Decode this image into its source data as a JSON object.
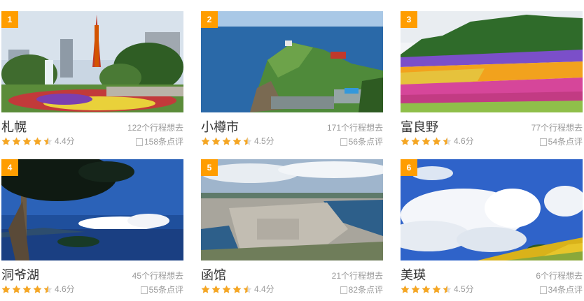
{
  "colors": {
    "rank_badge": "#ff9d00",
    "star": "#f5a623",
    "muted": "#999999",
    "title": "#333333"
  },
  "destinations": [
    {
      "rank": "1",
      "name": "札幌",
      "want": "122个行程想去",
      "rating": 4.4,
      "score": "4.4分",
      "reviews": "158条点评",
      "image": "sapporo-tv-tower-park"
    },
    {
      "rank": "2",
      "name": "小樽市",
      "want": "171个行程想去",
      "rating": 4.5,
      "score": "4.5分",
      "reviews": "56条点评",
      "image": "otaru-coastal-cape"
    },
    {
      "rank": "3",
      "name": "富良野",
      "want": "77个行程想去",
      "rating": 4.6,
      "score": "4.6分",
      "reviews": "54条点评",
      "image": "furano-flower-fields"
    },
    {
      "rank": "4",
      "name": "洞爷湖",
      "want": "45个行程想去",
      "rating": 4.6,
      "score": "4.6分",
      "reviews": "55条点评",
      "image": "toya-lake-tree"
    },
    {
      "rank": "5",
      "name": "函馆",
      "want": "21个行程想去",
      "rating": 4.4,
      "score": "4.4分",
      "reviews": "82条点评",
      "image": "hakodate-city-view"
    },
    {
      "rank": "6",
      "name": "美瑛",
      "want": "6个行程想去",
      "rating": 4.5,
      "score": "4.5分",
      "reviews": "34条点评",
      "image": "biei-sky-hill"
    }
  ]
}
